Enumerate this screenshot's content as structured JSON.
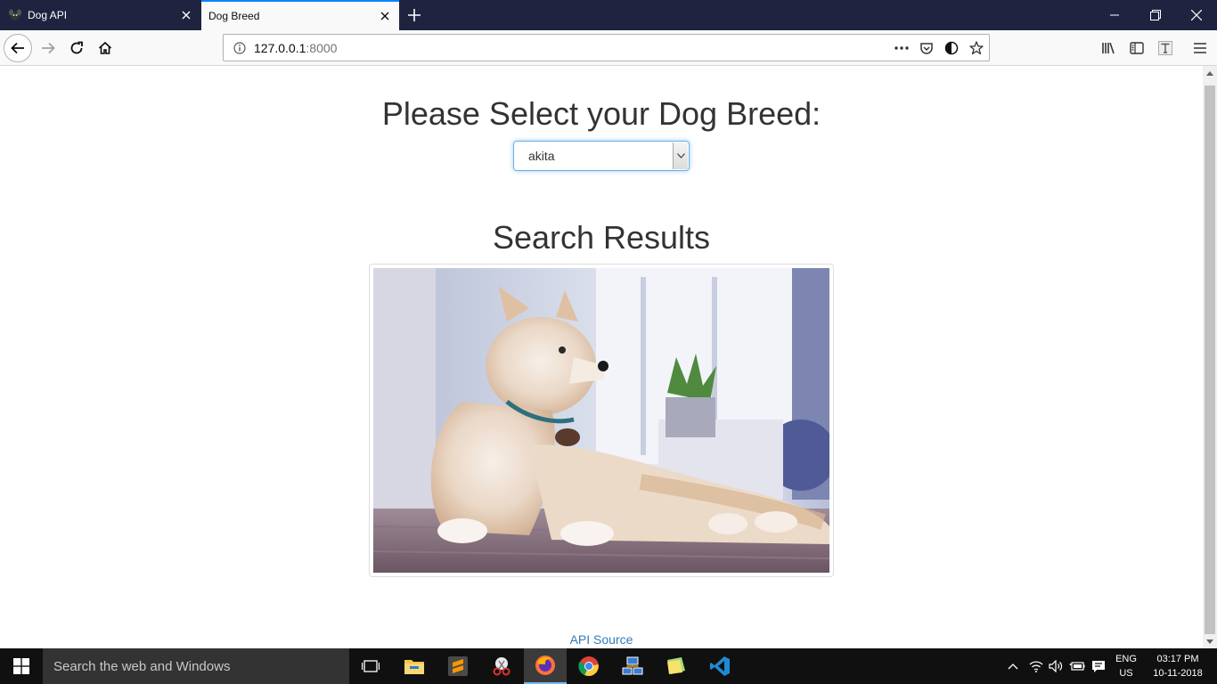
{
  "browser": {
    "tabs": [
      {
        "title": "Dog API",
        "active": false
      },
      {
        "title": "Dog Breed",
        "active": true
      }
    ],
    "url_host": "127.0.0.1",
    "url_port": ":8000"
  },
  "page": {
    "heading": "Please Select your Dog Breed:",
    "breed_select": {
      "selected": "akita"
    },
    "results_heading": "Search Results",
    "api_link": "API Source"
  },
  "taskbar": {
    "search_placeholder": "Search the web and Windows",
    "lang_top": "ENG",
    "lang_bottom": "US",
    "time": "03:17 PM",
    "date": "10-11-2018"
  },
  "colors": {
    "tab_strip": "#202340",
    "tab_accent": "#0a84ff",
    "heading_text": "#333333",
    "link": "#337ab7",
    "select_focus": "#66afe9",
    "taskbar": "#101010"
  },
  "icons": [
    "dog-favicon",
    "close-icon",
    "plus-icon",
    "minimize-icon",
    "restore-icon",
    "back-arrow-icon",
    "forward-arrow-icon",
    "reload-icon",
    "home-icon",
    "info-icon",
    "more-icon",
    "pocket-icon",
    "tracking-icon",
    "star-icon",
    "library-icon",
    "sidebar-icon",
    "text-icon",
    "hamburger-menu-icon",
    "windows-logo-icon",
    "task-view-icon",
    "file-explorer-icon",
    "sublime-text-icon",
    "snipping-tool-icon",
    "firefox-icon",
    "chrome-icon",
    "network-icon",
    "sticky-notes-icon",
    "vscode-icon",
    "chevron-up-icon",
    "wifi-icon",
    "volume-icon",
    "battery-icon",
    "notification-icon"
  ]
}
